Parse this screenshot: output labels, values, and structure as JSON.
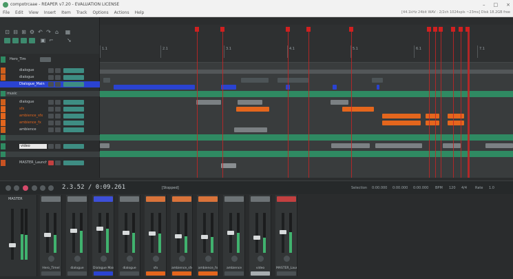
{
  "window": {
    "title": "compotrcaae - REAPER v7.20 - EVALUATION LICENSE",
    "controls": [
      "–",
      "□",
      "×"
    ]
  },
  "menu": {
    "items": [
      "File",
      "Edit",
      "View",
      "Insert",
      "Item",
      "Track",
      "Options",
      "Actions",
      "Help"
    ],
    "status": "[44.1kHz 24bit WAV : 2/2ch 1024spls ~23ms] Disk 18.2GB free"
  },
  "ruler": {
    "labels": [
      "1.1",
      "2.1",
      "3.1",
      "4.1",
      "5.1",
      "6.1",
      "7.1"
    ]
  },
  "tracks": [
    {
      "name": "Hero_Timeline",
      "color": "#2f8a62"
    },
    {
      "name": "dialogue",
      "color": "#cf5f1c"
    },
    {
      "name": "Dialogue_Main",
      "color": "#2a43d1"
    },
    {
      "name": "music",
      "color": "#2f8a62"
    },
    {
      "name": "dialogue",
      "color": "#cf5f1c"
    },
    {
      "name": "sfx",
      "color": "#e4661d"
    },
    {
      "name": "ambience_sfx",
      "color": "#e4661d"
    },
    {
      "name": "ambience_fx",
      "color": "#e4661d"
    },
    {
      "name": "ambience",
      "color": "#cf5f1c"
    },
    {
      "name": "video",
      "color": "#2f8a62"
    },
    {
      "name": "MASTER_Launch",
      "color": "#c85222"
    }
  ],
  "transport": {
    "time": "2.3.52 / 0:09.261",
    "status": "[Stopped]",
    "info": [
      "Selection",
      "0:00.000",
      "0:00.000",
      "0:00.000",
      "BPM",
      "120",
      "4/4",
      "Rate",
      "1.0"
    ]
  },
  "mixer": {
    "master_label": "MASTER",
    "strips": [
      {
        "name": "Hero_Timel",
        "top": "#6d7376",
        "bottom": "#4b5154",
        "level": 0.45
      },
      {
        "name": "dialogue",
        "top": "#6d7376",
        "bottom": "#4b5154",
        "level": 0.55
      },
      {
        "name": "Dialogue Main",
        "top": "#3d4fd8",
        "bottom": "#2a43d1",
        "level": 0.6
      },
      {
        "name": "dialogue",
        "top": "#6d7376",
        "bottom": "#4b5154",
        "level": 0.5
      },
      {
        "name": "sfx",
        "top": "#d9733a",
        "bottom": "#e4661d",
        "level": 0.48
      },
      {
        "name": "ambience_sfx",
        "top": "#d9733a",
        "bottom": "#e4661d",
        "level": 0.42
      },
      {
        "name": "ambience_fx",
        "top": "#d9733a",
        "bottom": "#e4661d",
        "level": 0.4
      },
      {
        "name": "ambience",
        "top": "#6d7376",
        "bottom": "#4b5154",
        "level": 0.5
      },
      {
        "name": "video",
        "top": "#6d7376",
        "bottom": "#a8adaf",
        "level": 0.38
      },
      {
        "name": "MASTER_Laun",
        "top": "#c34040",
        "bottom": "#4b5154",
        "level": 0.52
      }
    ]
  },
  "colors": {
    "marker_red": "#d02020",
    "item_blue": "#2a43d1",
    "item_orange": "#e4661d",
    "item_gray": "#8a8f92",
    "folder_green": "#2f8a62"
  }
}
